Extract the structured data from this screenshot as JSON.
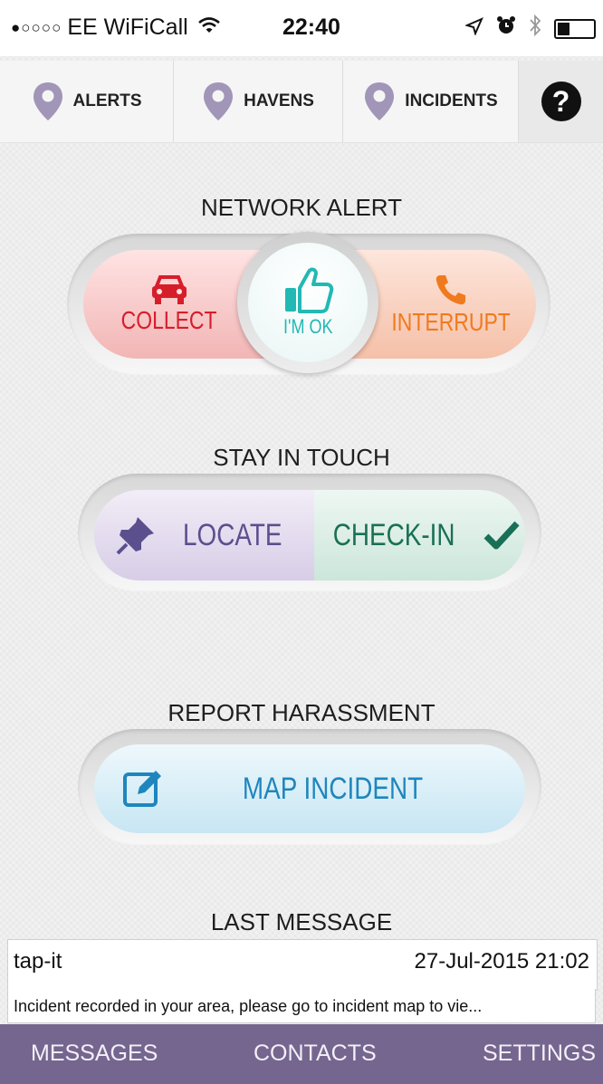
{
  "status_bar": {
    "signal_dots": "●○○○○",
    "carrier": "EE WiFiCall",
    "time": "22:40",
    "battery_level": 0.3
  },
  "top_tabs": [
    {
      "label": "ALERTS",
      "icon": "map-pin-icon"
    },
    {
      "label": "HAVENS",
      "icon": "map-pin-icon"
    },
    {
      "label": "INCIDENTS",
      "icon": "map-pin-icon"
    },
    {
      "label": "?",
      "icon": "help-icon"
    }
  ],
  "network_alert": {
    "title": "NETWORK ALERT",
    "collect_label": "COLLECT",
    "ok_label": "I'M OK",
    "interrupt_label": "INTERRUPT"
  },
  "stay_in_touch": {
    "title": "STAY IN TOUCH",
    "locate_label": "LOCATE",
    "checkin_label": "CHECK-IN"
  },
  "report": {
    "title": "REPORT HARASSMENT",
    "map_label": "MAP INCIDENT"
  },
  "last_message": {
    "title": "LAST MESSAGE",
    "sender": "tap-it",
    "timestamp": "27-Jul-2015 21:02",
    "preview": "Incident recorded in your area, please go to incident map to vie..."
  },
  "bottom_nav": {
    "messages": "MESSAGES",
    "contacts": "CONTACTS",
    "settings": "SETTINGS"
  },
  "colors": {
    "collect": "#d61e2a",
    "ok": "#22b8b4",
    "interrupt": "#f07a1e",
    "locate": "#5b4f8e",
    "checkin": "#197056",
    "map": "#1f86bd",
    "nav_bg": "#75668f",
    "pin": "#a195b8"
  }
}
